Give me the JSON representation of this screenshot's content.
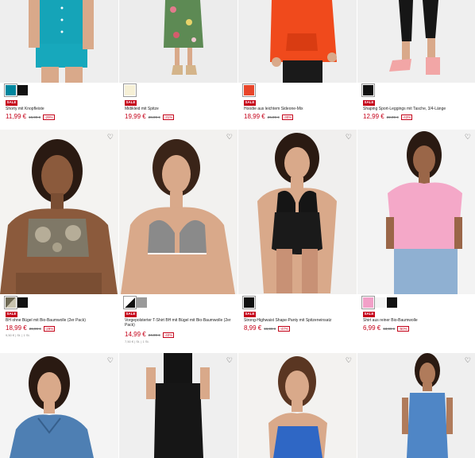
{
  "products": [
    {
      "title": "Shorty mit Knopfleiste",
      "price": "11,99 €",
      "old_price": "16,99 €",
      "discount": "-29%",
      "badge": "SALE",
      "swatches": [
        "#00869e",
        "#111111"
      ]
    },
    {
      "title": "Midikleid mit Spitze",
      "price": "19,99 €",
      "old_price": "28,99 €",
      "discount": "-31%",
      "badge": "SALE",
      "swatches": [
        "#f6f0d6"
      ]
    },
    {
      "title": "Hoodie aus leichtem Sideone-Mix",
      "price": "18,99 €",
      "old_price": "26,99 €",
      "discount": "-30%",
      "badge": "SALE",
      "swatches": [
        "#e8452a"
      ]
    },
    {
      "title": "Shaping Sport-Leggings mit Tasche, 3/4-Länge",
      "price": "12,99 €",
      "old_price": "22,99 €",
      "discount": "-43%",
      "badge": "SALE",
      "swatches": [
        "#111111"
      ]
    },
    {
      "title": "BH ohne Bügel mit Bio-Baumwolle (2er Pack)",
      "price": "18,99 €",
      "old_price": "26,99 €",
      "discount": "-29%",
      "badge": "SALE",
      "unit": "9,50 € | St. | 1 St.",
      "swatches": [
        "#6f6a55",
        "#111111"
      ]
    },
    {
      "title": "Vorgepolsterter T-Shirt BH mit Bügel mit Bio-Baumwolle (2er Pack)",
      "price": "14,99 €",
      "old_price": "24,99 €",
      "discount": "-40%",
      "badge": "SALE",
      "unit": "7,50 € | St. | 1 St.",
      "swatches": [
        "#ffffff",
        "#9a9a9a"
      ]
    },
    {
      "title": "Strong-Highwaist Shape-Panty mit Spitzeneinsatz",
      "price": "8,99 €",
      "old_price": "16,99 €",
      "discount": "-47%",
      "badge": "SALE",
      "swatches": [
        "#111111"
      ]
    },
    {
      "title": "Shirt aus reiner Bio-Baumwolle",
      "price": "6,99 €",
      "old_price": "13,99 €",
      "discount": "-50%",
      "badge": "SALE",
      "swatches": [
        "#f2a0c8",
        "#f4f4f4",
        "#111111"
      ]
    },
    {
      "title": "",
      "price": "",
      "old_price": "",
      "discount": "",
      "badge": "",
      "swatches": []
    },
    {
      "title": "",
      "price": "",
      "old_price": "",
      "discount": "",
      "badge": "",
      "swatches": []
    },
    {
      "title": "",
      "price": "",
      "old_price": "",
      "discount": "",
      "badge": "",
      "swatches": []
    },
    {
      "title": "",
      "price": "",
      "old_price": "",
      "discount": "",
      "badge": "",
      "swatches": []
    }
  ],
  "icons": {
    "wishlist": "heart-outline-icon"
  }
}
